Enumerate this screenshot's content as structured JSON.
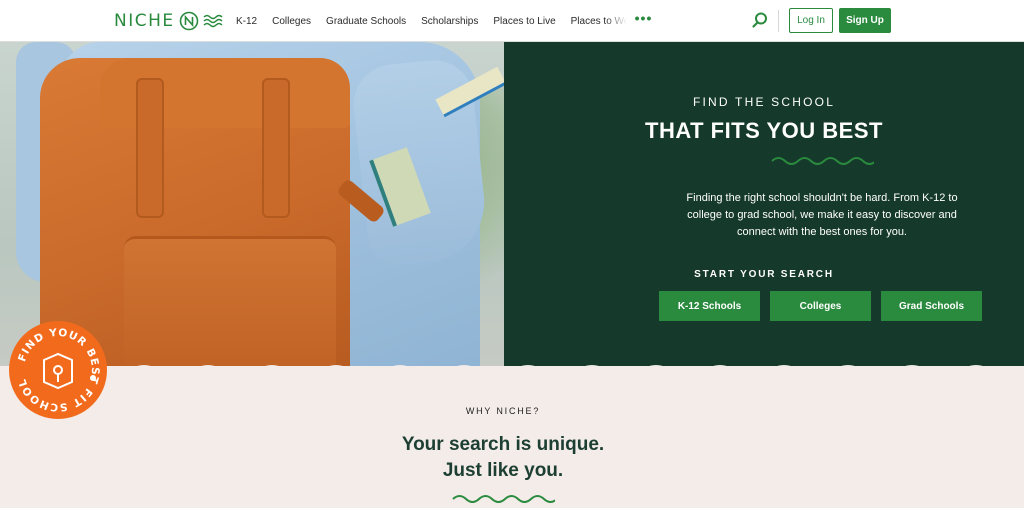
{
  "header": {
    "logo_text": "NICHE",
    "nav": [
      "K-12",
      "Colleges",
      "Graduate Schools",
      "Scholarships",
      "Places to Live",
      "Places to Work"
    ],
    "more_icon": "more-dots-icon",
    "search_icon": "search-icon",
    "login_label": "Log In",
    "signup_label": "Sign Up"
  },
  "hero": {
    "kicker": "FIND THE SCHOOL",
    "headline": "THAT FITS YOU BEST",
    "lead": "Finding the right school shouldn't be hard. From K-12 to college to grad school, we make it easy to discover and connect with the best ones for you.",
    "search_kicker": "START YOUR SEARCH",
    "ctas": [
      "K-12 Schools",
      "Colleges",
      "Grad Schools"
    ]
  },
  "badge": {
    "text": "FIND YOUR BEST FIT SCHOOL"
  },
  "why": {
    "kicker": "WHY NICHE?",
    "line1": "Your search is unique.",
    "line2": "Just like you."
  },
  "colors": {
    "brand_green": "#2a8a3e",
    "dark_green": "#15392a",
    "badge_orange": "#f26b1d",
    "cream": "#f3ece8"
  }
}
